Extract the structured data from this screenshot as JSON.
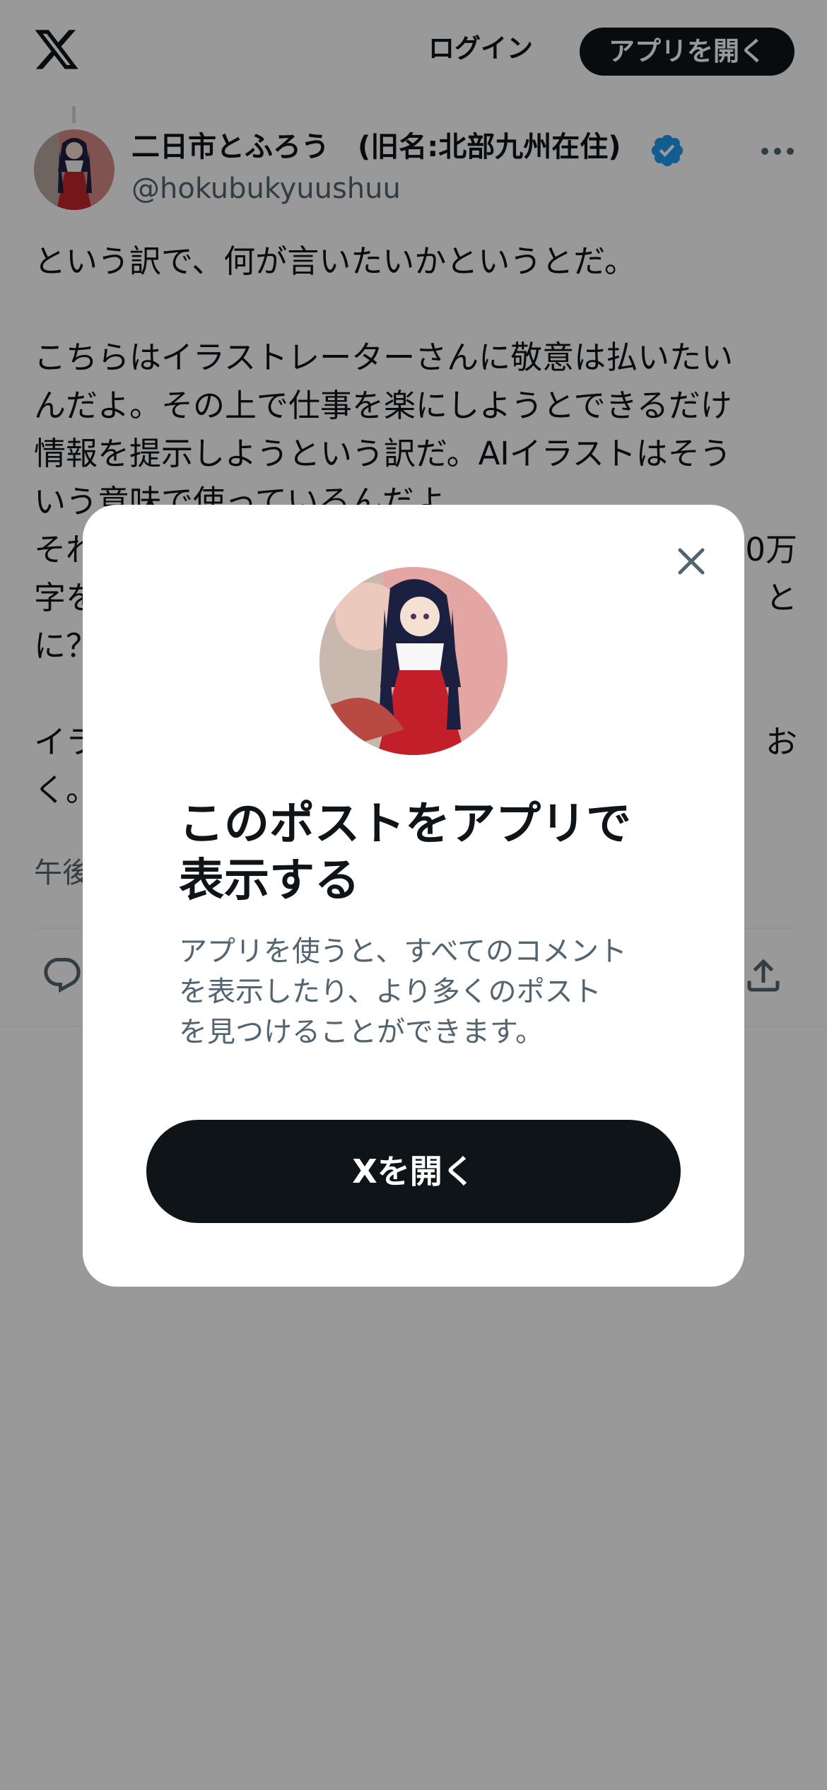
{
  "header": {
    "logo_icon": "x-logo-icon",
    "login_label": "ログイン",
    "open_app_label": "アプリを開く"
  },
  "tweet": {
    "author_name": "二日市とふろう　(旧名:北部九州在住)",
    "author_handle": "@hokubukyuushuu",
    "verified_icon": "verified-badge-icon",
    "verified_color": "#1d9bf0",
    "more_icon": "more-icon",
    "lines": [
      "という訳で、何が言いたいかというとだ。",
      "",
      "こちらはイラストレーターさんに敬意は払いたい",
      "んだよ。その上で仕事を楽にしようとできるだけ",
      "情報を提示しようという訳だ。AIイラストはそう",
      "いう意味で使っているんだよ。",
      "それ",
      "字を",
      "に？",
      "",
      "イラ",
      "く。"
    ],
    "right_fragments": {
      "line7": "0万",
      "line8": "と",
      "line11": "お"
    },
    "timestamp": "午後",
    "reply_icon": "reply-icon",
    "share_icon": "share-icon"
  },
  "modal": {
    "close_icon": "close-icon",
    "title": "このポストをアプリで\n表示する",
    "description": "アプリを使うと、すべてのコメント\nを表示したり、より多くのポスト\nを見つけることができます。",
    "open_button_label": "Xを開く"
  },
  "colors": {
    "text_primary": "#0f1419",
    "text_secondary": "#536471",
    "button_dark": "#0f1419",
    "overlay": "rgba(0,0,0,0.4)"
  }
}
